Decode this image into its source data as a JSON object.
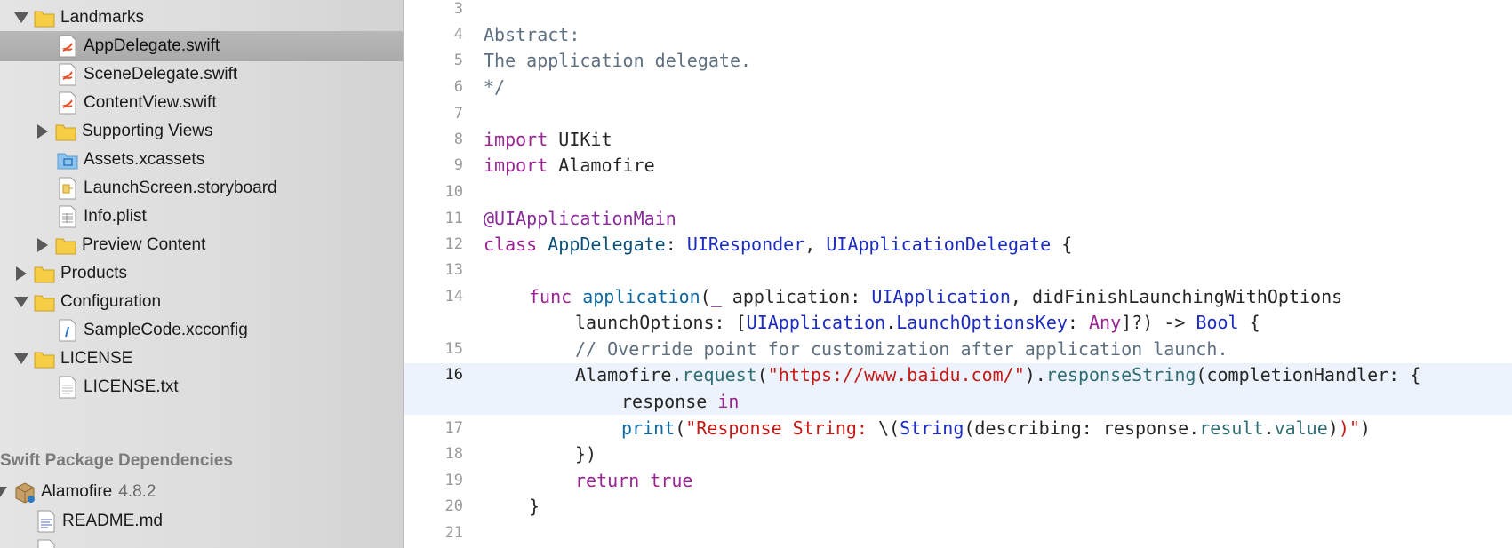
{
  "navigator": {
    "items": [
      {
        "label": "Landmarks",
        "kind": "folder-yellow",
        "expanded": true
      },
      {
        "label": "AppDelegate.swift",
        "kind": "swift-file"
      },
      {
        "label": "SceneDelegate.swift",
        "kind": "swift-file"
      },
      {
        "label": "ContentView.swift",
        "kind": "swift-file"
      },
      {
        "label": "Supporting Views",
        "kind": "folder-yellow",
        "expanded": false
      },
      {
        "label": "Assets.xcassets",
        "kind": "folder-blue"
      },
      {
        "label": "LaunchScreen.storyboard",
        "kind": "storyboard-file"
      },
      {
        "label": "Info.plist",
        "kind": "plist-file"
      },
      {
        "label": "Preview Content",
        "kind": "folder-yellow",
        "expanded": false
      },
      {
        "label": "Products",
        "kind": "folder-yellow",
        "expanded": false
      },
      {
        "label": "Configuration",
        "kind": "folder-yellow",
        "expanded": true
      },
      {
        "label": "SampleCode.xcconfig",
        "kind": "xcconfig-file"
      },
      {
        "label": "LICENSE",
        "kind": "folder-yellow",
        "expanded": true
      },
      {
        "label": "LICENSE.txt",
        "kind": "text-file"
      }
    ],
    "selected": "AppDelegate.swift",
    "packages_header": "Swift Package Dependencies",
    "package": {
      "name": "Alamofire",
      "version": "4.8.2"
    },
    "package_children": [
      "README.md"
    ]
  },
  "editor": {
    "current_line": "16",
    "line_numbers": [
      "3",
      "4",
      "5",
      "6",
      "7",
      "8",
      "9",
      "10",
      "11",
      "12",
      "13",
      "14",
      "15",
      "16",
      "17",
      "18",
      "19",
      "20",
      "21"
    ],
    "lines": {
      "l4": "Abstract:",
      "l5": "The application delegate.",
      "l6": "*/",
      "l8_kw": "import",
      "l8_rest": " UIKit",
      "l9_kw": "import",
      "l9_rest": " Alamofire",
      "l11": "@UIApplicationMain",
      "l12_kw": "class",
      "l12_name": "AppDelegate",
      "l12_colon": ": ",
      "l12_t1": "UIResponder",
      "l12_comma": ", ",
      "l12_t2": "UIApplicationDelegate",
      "l12_end": " {",
      "l14_kw": "func",
      "l14_fn": "application",
      "l14_p1": "(",
      "l14_us": "_",
      "l14_p2": " application: ",
      "l14_t1": "UIApplication",
      "l14_p3": ", didFinishLaunchingWithOptions",
      "l14b_p1": "launchOptions: [",
      "l14b_t1": "UIApplication",
      "l14b_dot": ".",
      "l14b_t2": "LaunchOptionsKey",
      "l14b_p2": ": ",
      "l14b_any": "Any",
      "l14b_p3": "]?) -> ",
      "l14b_bool": "Bool",
      "l14b_end": " {",
      "l15": "// Override point for customization after application launch.",
      "l16_obj": "Alamofire",
      "l16_dot": ".",
      "l16_m1": "request",
      "l16_p1": "(",
      "l16_str": "\"https://www.baidu.com/\"",
      "l16_p2": ").",
      "l16_m2": "responseString",
      "l16_p3": "(completionHandler: {",
      "l16b_p1": "response ",
      "l16b_kw": "in",
      "l17_fn": "print",
      "l17_p1": "(",
      "l17_s1": "\"Response String: ",
      "l17_esc": "\\(",
      "l17_t": "String",
      "l17_p2": "(describing: response.",
      "l17_m1": "result",
      "l17_dot": ".",
      "l17_m2": "value",
      "l17_p3": ")",
      "l17_s2": ")\"",
      "l17_end": ")",
      "l18": "})",
      "l19_kw": "return",
      "l19_true": "true",
      "l20": "}"
    }
  },
  "colors": {
    "keyword": "#9b2393",
    "type": "#1c2cc0",
    "string": "#c41a16",
    "comment": "#5f7080",
    "current_line_bg": "#ecf3fd",
    "selection_bg": "#b0b0b0"
  }
}
